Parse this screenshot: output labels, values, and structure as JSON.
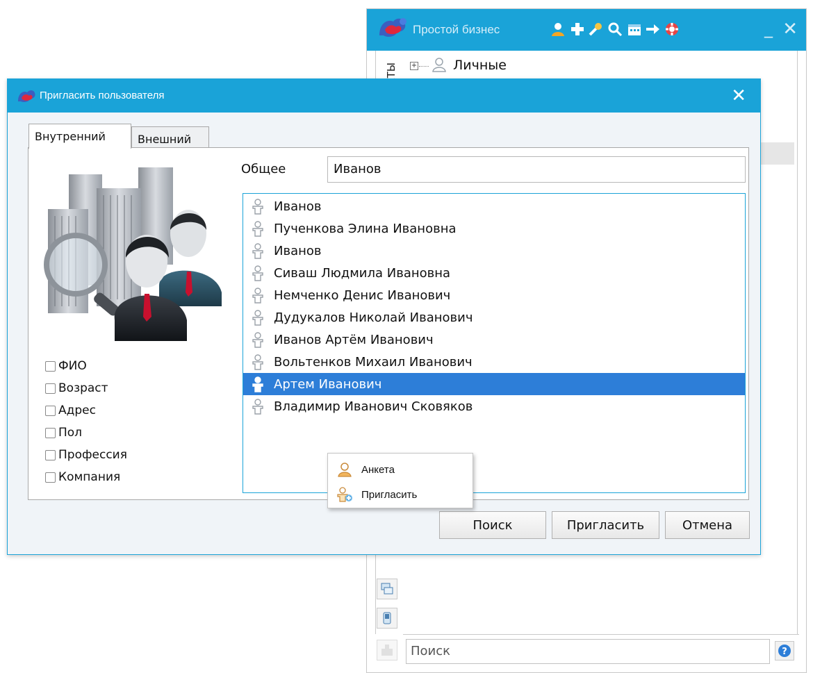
{
  "main_window": {
    "title": "Простой бизнес",
    "side_tab": "КТЫ",
    "tree_item": "Личные",
    "search_placeholder": "Поиск",
    "toolbar_icons": [
      "user-icon",
      "plus-icon",
      "wrench-icon",
      "search-icon",
      "calendar-icon",
      "arrow-right-icon",
      "lifebuoy-icon"
    ],
    "minimize": "_",
    "close": "✕"
  },
  "dialog": {
    "title": "Пригласить пользователя",
    "close": "✕",
    "tabs": [
      {
        "label": "Внутренний",
        "active": true
      },
      {
        "label": "Внешний",
        "active": false
      }
    ],
    "filters": [
      {
        "label": "ФИО",
        "checked": false
      },
      {
        "label": "Возраст",
        "checked": false
      },
      {
        "label": "Адрес",
        "checked": false
      },
      {
        "label": "Пол",
        "checked": false
      },
      {
        "label": "Профессия",
        "checked": false
      },
      {
        "label": "Компания",
        "checked": false
      }
    ],
    "general_label": "Общее",
    "general_value": "Иванов",
    "results": [
      {
        "name": "Иванов",
        "selected": false
      },
      {
        "name": "Пученкова Элина Ивановна",
        "selected": false
      },
      {
        "name": "Иванов",
        "selected": false
      },
      {
        "name": "Сиваш Людмила Ивановна",
        "selected": false
      },
      {
        "name": "Немченко Денис Иванович",
        "selected": false
      },
      {
        "name": "Дудукалов Николай Иванович",
        "selected": false
      },
      {
        "name": "Иванов Артём Иванович",
        "selected": false
      },
      {
        "name": "Вольтенков Михаил Иванович",
        "selected": false
      },
      {
        "name": "Артем Иванович",
        "selected": true
      },
      {
        "name": "Владимир Иванович Сковяков",
        "selected": false
      }
    ],
    "context_menu": [
      {
        "label": "Анкета",
        "icon": "profile-icon"
      },
      {
        "label": "Пригласить",
        "icon": "invite-icon"
      }
    ],
    "buttons": {
      "search": "Поиск",
      "invite": "Пригласить",
      "cancel": "Отмена"
    }
  },
  "colors": {
    "titlebar": "#1aa3d8",
    "selection": "#2d7ed8"
  }
}
